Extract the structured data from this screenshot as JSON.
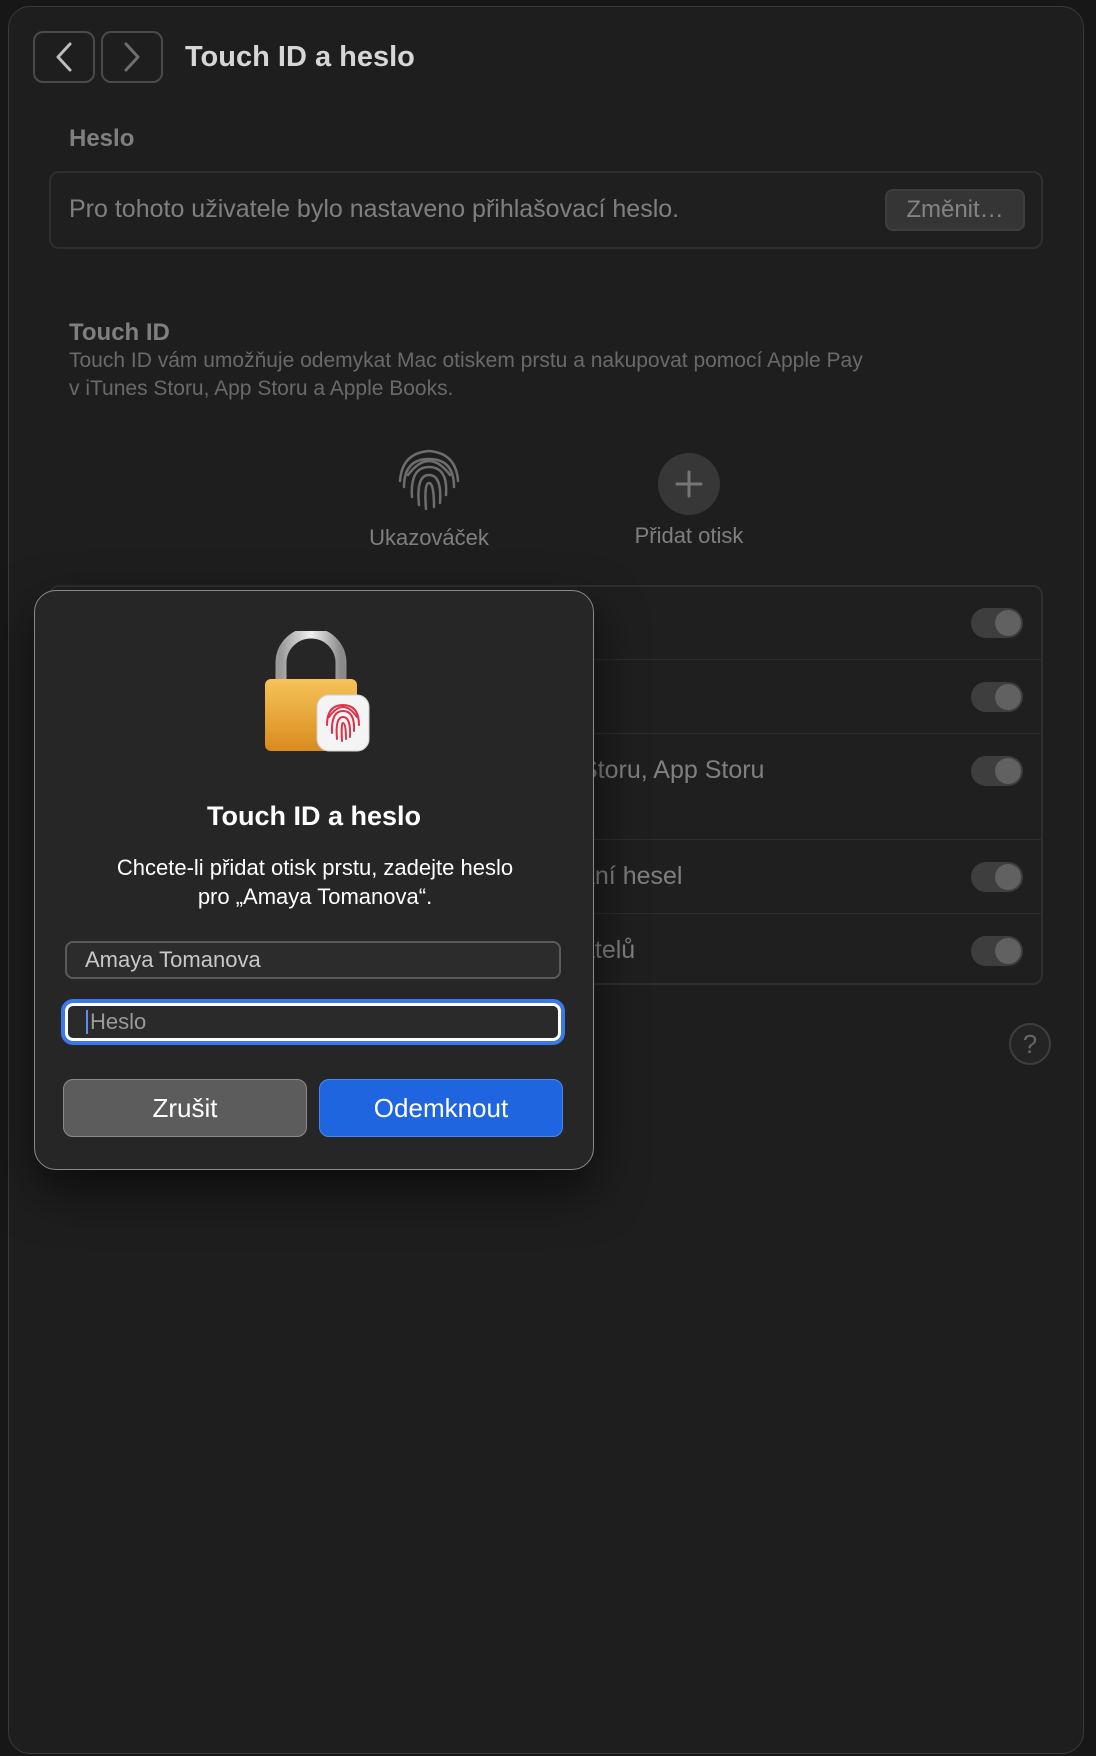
{
  "toolbar": {
    "back_icon": "chevron-left-icon",
    "forward_icon": "chevron-right-icon",
    "title": "Touch ID a heslo"
  },
  "password_section": {
    "title": "Heslo",
    "status": "Pro tohoto uživatele bylo nastaveno přihlašovací heslo.",
    "change_label": "Změnit…"
  },
  "touchid_section": {
    "title": "Touch ID",
    "description_line1": "Touch ID vám umožňuje odemykat Mac otiskem prstu a nakupovat pomocí Apple Pay",
    "description_line2": "v iTunes Storu, App Storu a Apple Books.",
    "fingerprints": [
      {
        "label": "Ukazováček",
        "icon": "fingerprint-icon"
      },
      {
        "label": "Přidat otisk",
        "icon": "plus-icon"
      }
    ]
  },
  "settings_rows": [
    {
      "label": "",
      "on": true
    },
    {
      "label": "",
      "on": true
    },
    {
      "label": "Storu, App Storu",
      "on": true
    },
    {
      "label": "ání hesel",
      "on": true
    },
    {
      "label": "atelů",
      "on": true
    }
  ],
  "help_label": "?",
  "dialog": {
    "icon": "lock-fingerprint-icon",
    "title": "Touch ID a heslo",
    "message_line1": "Chcete-li přidat otisk prstu, zadejte heslo",
    "message_line2": "pro „Amaya Tomanova“.",
    "username_value": "Amaya Tomanova",
    "password_placeholder": "Heslo",
    "cancel_label": "Zrušit",
    "unlock_label": "Odemknout",
    "accent_color": "#1f65e0"
  }
}
